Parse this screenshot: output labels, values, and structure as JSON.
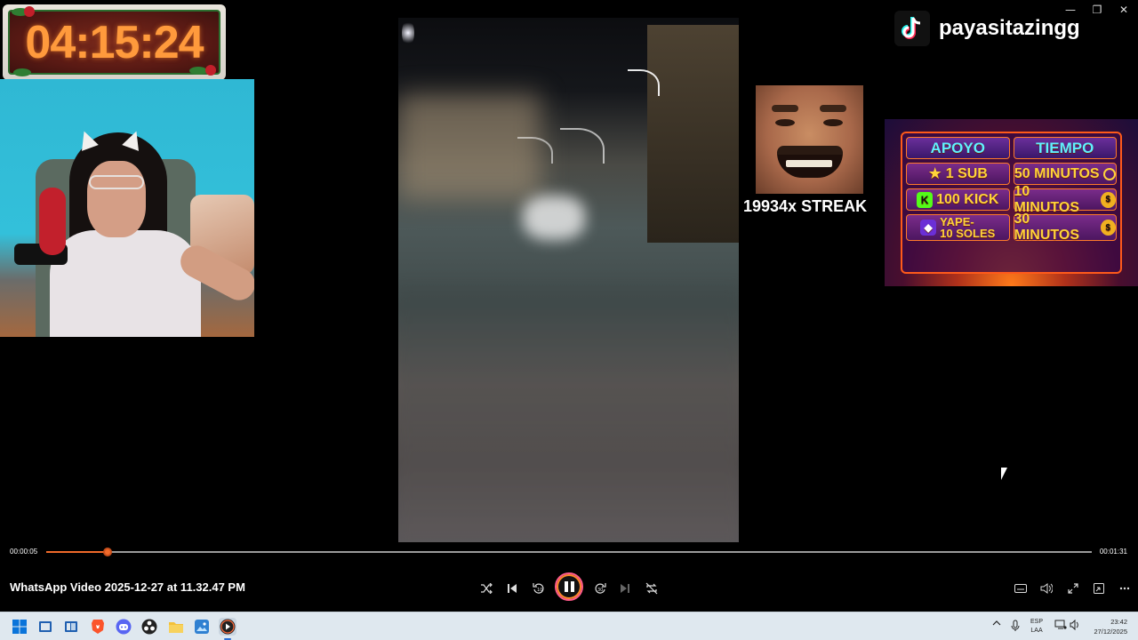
{
  "window": {
    "minimize_glyph": "—",
    "restore_glyph": "❐",
    "close_glyph": "✕"
  },
  "overlay": {
    "countdown": "04:15:24",
    "tiktok_username": "payasitazingg",
    "streak_label": "19934x STREAK",
    "support_table": {
      "headers": [
        "APOYO",
        "TIEMPO"
      ],
      "rows": [
        {
          "icon": "star-icon",
          "support": "1 SUB",
          "time": "50 MINUTOS",
          "time_icon": "clock-icon"
        },
        {
          "icon": "kick-icon",
          "support": "100 KICK",
          "time": "10 MINUTOS",
          "time_icon": "money-bag-icon"
        },
        {
          "icon": "yape-icon",
          "support": "YAPE-\n10 SOLES",
          "time": "30 MINUTOS",
          "time_icon": "money-bag-icon"
        }
      ]
    }
  },
  "player": {
    "current_time": "00:00:05",
    "total_time": "00:01:31",
    "progress_fraction": 0.0588,
    "video_title": "WhatsApp Video 2025-12-27 at 11.32.47 PM",
    "accent_color": "#f06a2a",
    "controls": {
      "shuffle": "shuffle-icon",
      "previous": "previous-icon",
      "rewind": "rewind-10-icon",
      "play_pause": "pause-icon",
      "forward": "forward-30-icon",
      "next": "next-icon",
      "repeat": "repeat-off-icon",
      "captions": "captions-icon",
      "volume": "volume-icon",
      "fullscreen": "fullscreen-icon",
      "miniplayer": "miniplayer-icon",
      "more": "more-icon"
    }
  },
  "taskbar": {
    "apps": [
      "windows-start-icon",
      "task-view-icon",
      "widgets-icon",
      "brave-icon",
      "discord-icon",
      "obs-icon",
      "file-explorer-icon",
      "photos-icon",
      "media-player-icon"
    ],
    "language_line1": "ESP",
    "language_line2": "LAA",
    "time": "23:42",
    "date": "27/12/2025"
  }
}
